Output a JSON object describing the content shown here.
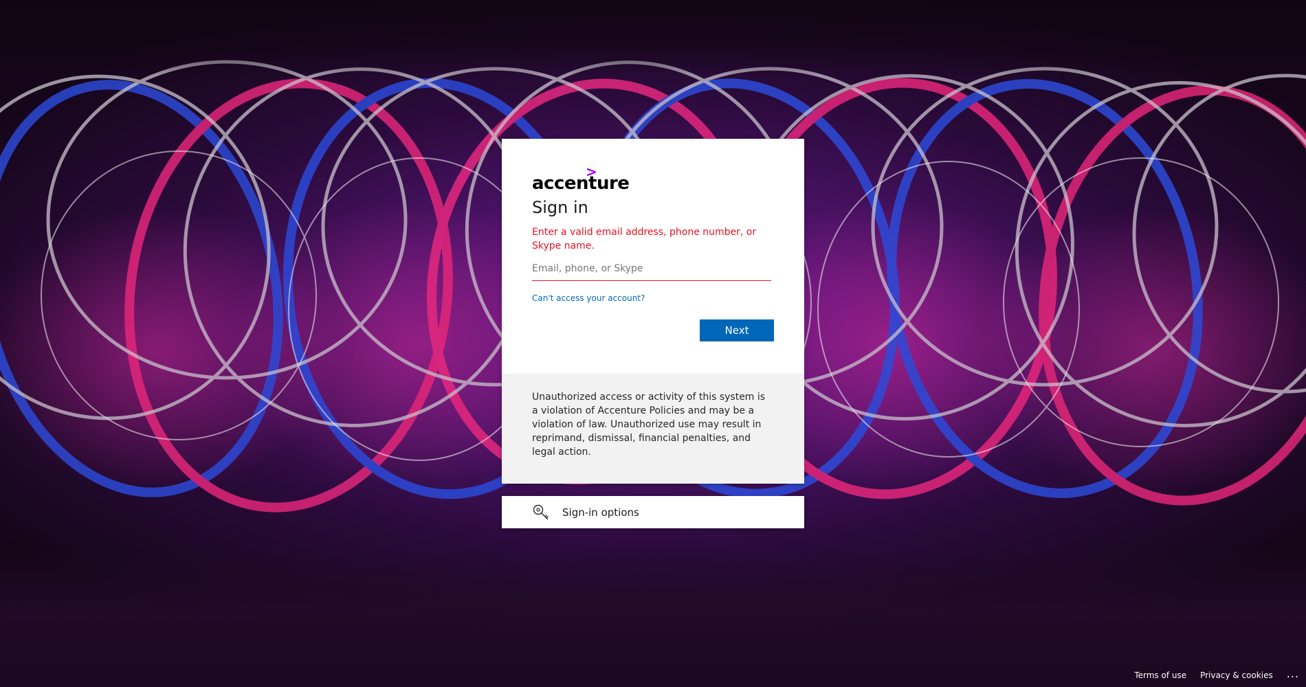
{
  "brand": {
    "logo_text": "accenture",
    "logo_mark": ">",
    "accent_color": "#a100ff"
  },
  "signin": {
    "title": "Sign in",
    "error_message": "Enter a valid email address, phone number, or Skype name.",
    "input_placeholder": "Email, phone, or Skype",
    "input_value": "",
    "cant_access_link": "Can't access your account?",
    "next_button": "Next",
    "error_color": "#e81123",
    "button_color": "#0067b8"
  },
  "notice": {
    "text": "Unauthorized access or activity of this system is a violation of Accenture Policies and may be a violation of law. Unauthorized use may result in reprimand, dismissal, financial penalties, and legal action."
  },
  "signin_options": {
    "icon": "key-search-icon",
    "label": "Sign-in options"
  },
  "footer": {
    "terms": "Terms of use",
    "privacy": "Privacy & cookies",
    "more": "..."
  }
}
